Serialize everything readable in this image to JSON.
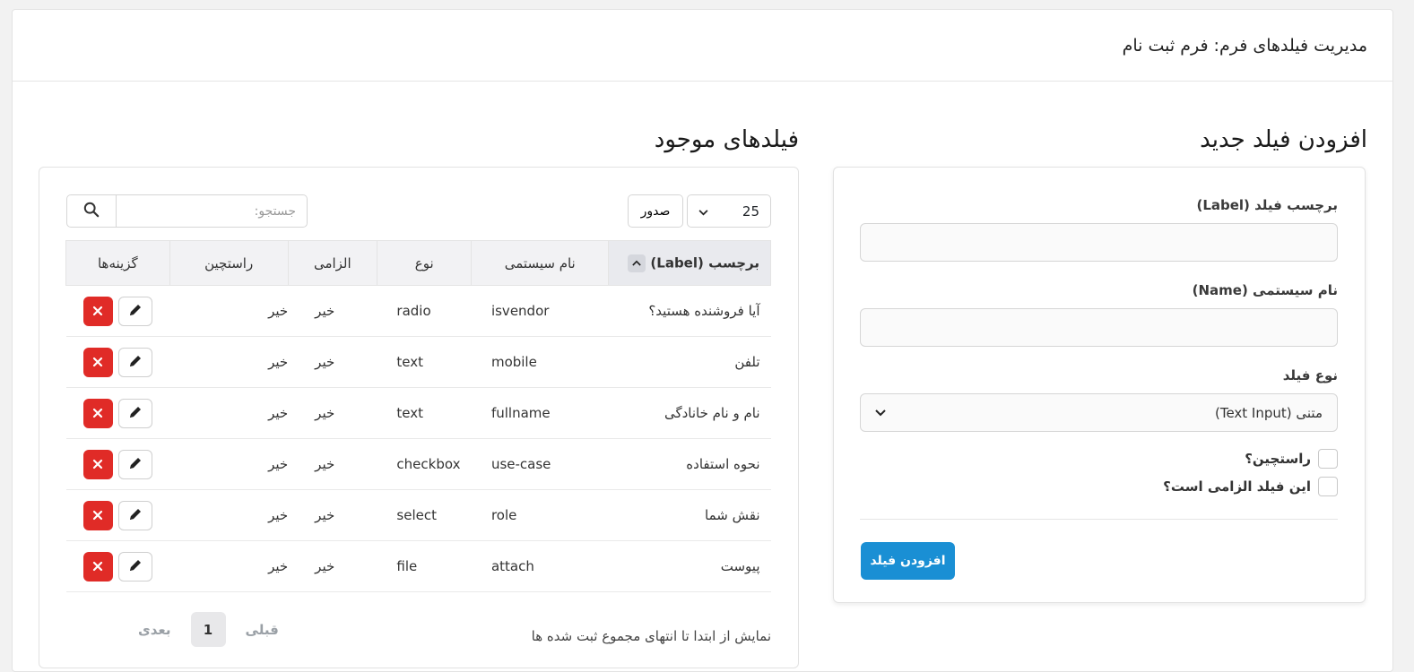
{
  "header": {
    "title": "مدیریت فیلدهای فرم: فرم ثبت نام"
  },
  "form": {
    "title": "افزودن فیلد جدید",
    "label_field": "برچسب فیلد (Label)",
    "name_field": "نام سیستمی (Name)",
    "type_field": "نوع فیلد",
    "type_value": "متنی (Text Input)",
    "rtl_checkbox": "راستچین؟",
    "required_checkbox": "این فیلد الزامی است؟",
    "submit": "افزودن فیلد"
  },
  "list": {
    "title": "فیلدهای موجود",
    "page_size": "25",
    "export": "صدور",
    "search_placeholder": "جستجو:",
    "columns": [
      "برچسب (Label)",
      "نام سیستمی",
      "نوع",
      "الزامی",
      "راستچین",
      "گزینه‌ها"
    ],
    "rows": [
      {
        "label": "آیا فروشنده هستید؟",
        "name": "isvendor",
        "type": "radio",
        "required": "خیر",
        "rtl": "خیر"
      },
      {
        "label": "تلفن",
        "name": "mobile",
        "type": "text",
        "required": "خیر",
        "rtl": "خیر"
      },
      {
        "label": "نام و نام خانادگی",
        "name": "fullname",
        "type": "text",
        "required": "خیر",
        "rtl": "خیر"
      },
      {
        "label": "نحوه استفاده",
        "name": "use-case",
        "type": "checkbox",
        "required": "خیر",
        "rtl": "خیر"
      },
      {
        "label": "نقش شما",
        "name": "role",
        "type": "select",
        "required": "خیر",
        "rtl": "خیر"
      },
      {
        "label": "پیوست",
        "name": "attach",
        "type": "file",
        "required": "خیر",
        "rtl": "خیر"
      }
    ],
    "info": "نمایش از ابتدا تا انتهای مجموع ثبت شده ها",
    "pager": {
      "prev": "قبلی",
      "current": "1",
      "next": "بعدی"
    }
  },
  "colors": {
    "primary": "#1a8fd4",
    "danger": "#e02b27"
  }
}
